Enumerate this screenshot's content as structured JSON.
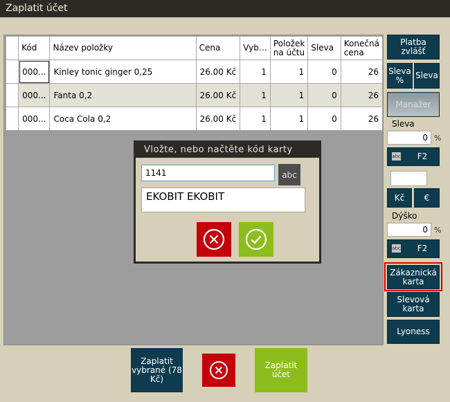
{
  "window": {
    "title": "Zaplatit účet"
  },
  "grid": {
    "columns": [
      "Kód",
      "Název položky",
      "Cena",
      "Vyb…",
      "Položek na účtu",
      "Sleva",
      "Konečná cena"
    ],
    "rows": [
      {
        "code": "000...",
        "name": "Kinley tonic ginger 0,25",
        "price": "26.00 Kč",
        "selected": "1",
        "on_account": "1",
        "discount": "0",
        "final": "26"
      },
      {
        "code": "000...",
        "name": "Fanta 0,2",
        "price": "26.00 Kč",
        "selected": "1",
        "on_account": "1",
        "discount": "0",
        "final": "26"
      },
      {
        "code": "000...",
        "name": "Coca Cola 0,2",
        "price": "26.00 Kč",
        "selected": "1",
        "on_account": "1",
        "discount": "0",
        "final": "26"
      }
    ]
  },
  "right_panel": {
    "pay_separately": "Platba zvlášť",
    "discount_pct_btn": "Sleva %",
    "discount_btn": "Sleva",
    "manager_btn": "Manažer",
    "discount_label": "Sleva",
    "discount_value": "0",
    "discount_unit": "%",
    "abc_mini": "abc",
    "f2_label": "F2",
    "currency_input_value": "",
    "kc_btn": "Kč",
    "eur_btn": "€",
    "tip_label": "Dýško",
    "tip_value": "0",
    "tip_unit": "%",
    "customer_card_btn": "Zákaznická karta",
    "discount_card_btn": "Slevová karta",
    "lyoness_btn": "Lyoness"
  },
  "dialog": {
    "title": "Vložte, nebo načtěte kód karty",
    "code_value": "1141",
    "abc_label": "abc",
    "customer_name": "EKOBIT EKOBIT"
  },
  "bottom": {
    "pay_selected_label": "Zaplatit vybrané (78 Kč)",
    "pay_all_label": "Zaplatit účet"
  },
  "colors": {
    "title_bar": "#2c2a24",
    "background": "#d6d0b8",
    "button_dark": "#0e3b4e",
    "cancel_red": "#c4000b",
    "confirm_green": "#8dbd1c",
    "highlight": "#e00000"
  }
}
